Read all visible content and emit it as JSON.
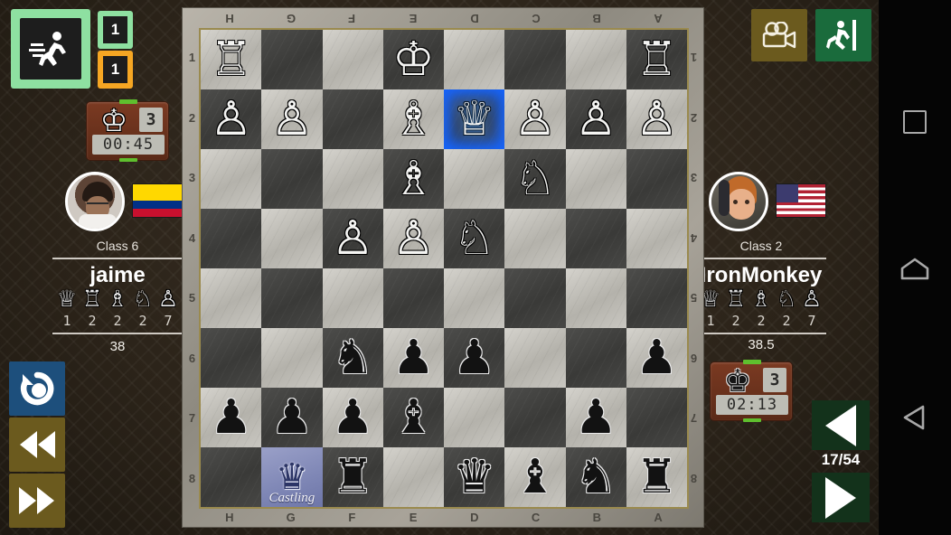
{
  "hud": {
    "run_icon": "running-man-icon",
    "counter_green": "1",
    "counter_amber": "1",
    "record_icon": "video-camera-icon",
    "exit_icon": "exit-door-icon",
    "rotate_icon": "rotate-refresh-icon",
    "rewind_icon": "rewind-icon",
    "forward_icon": "fast-forward-icon"
  },
  "clocks": {
    "white": {
      "time": "00:45",
      "increment": "3",
      "king": "white-king-icon"
    },
    "black": {
      "time": "02:13",
      "increment": "3",
      "king": "black-king-icon"
    }
  },
  "players": {
    "left": {
      "class": "Class 6",
      "name": "jaime",
      "flag": "colombia-flag",
      "score": "38",
      "material": [
        {
          "piece": "queen",
          "glyph": "♕",
          "count": "1"
        },
        {
          "piece": "rook",
          "glyph": "♖",
          "count": "2"
        },
        {
          "piece": "bishop",
          "glyph": "♗",
          "count": "2"
        },
        {
          "piece": "knight",
          "glyph": "♘",
          "count": "2"
        },
        {
          "piece": "pawn",
          "glyph": "♙",
          "count": "7"
        }
      ]
    },
    "right": {
      "class": "Class 2",
      "name": "IronMonkey",
      "flag": "usa-flag",
      "score": "38.5",
      "material": [
        {
          "piece": "queen",
          "glyph": "♕",
          "count": "1"
        },
        {
          "piece": "rook",
          "glyph": "♖",
          "count": "2"
        },
        {
          "piece": "bishop",
          "glyph": "♗",
          "count": "2"
        },
        {
          "piece": "knight",
          "glyph": "♘",
          "count": "2"
        },
        {
          "piece": "pawn",
          "glyph": "♙",
          "count": "7"
        }
      ]
    }
  },
  "move_nav": {
    "counter": "17/54",
    "prev_label": "prev-move",
    "next_label": "next-move"
  },
  "board": {
    "files": [
      "H",
      "G",
      "F",
      "E",
      "D",
      "C",
      "B",
      "A"
    ],
    "ranks": [
      "1",
      "2",
      "3",
      "4",
      "5",
      "6",
      "7",
      "8"
    ],
    "selected_square": "D2",
    "castling_square": "G8",
    "castling_label": "Castling",
    "squares": [
      [
        {
          "p": "R",
          "c": "w"
        },
        {
          "p": "",
          "c": ""
        },
        {
          "p": "",
          "c": ""
        },
        {
          "p": "K",
          "c": "w"
        },
        {
          "p": "",
          "c": ""
        },
        {
          "p": "",
          "c": ""
        },
        {
          "p": "",
          "c": ""
        },
        {
          "p": "R",
          "c": "w"
        }
      ],
      [
        {
          "p": "P",
          "c": "w"
        },
        {
          "p": "P",
          "c": "w"
        },
        {
          "p": "",
          "c": ""
        },
        {
          "p": "B",
          "c": "w"
        },
        {
          "p": "Q",
          "c": "w"
        },
        {
          "p": "P",
          "c": "w"
        },
        {
          "p": "P",
          "c": "w"
        },
        {
          "p": "P",
          "c": "w"
        }
      ],
      [
        {
          "p": "",
          "c": ""
        },
        {
          "p": "",
          "c": ""
        },
        {
          "p": "",
          "c": ""
        },
        {
          "p": "B",
          "c": "w"
        },
        {
          "p": "",
          "c": ""
        },
        {
          "p": "N",
          "c": "w"
        },
        {
          "p": "",
          "c": ""
        },
        {
          "p": "",
          "c": ""
        }
      ],
      [
        {
          "p": "",
          "c": ""
        },
        {
          "p": "",
          "c": ""
        },
        {
          "p": "P",
          "c": "w"
        },
        {
          "p": "P",
          "c": "w"
        },
        {
          "p": "N",
          "c": "w"
        },
        {
          "p": "",
          "c": ""
        },
        {
          "p": "",
          "c": ""
        },
        {
          "p": "",
          "c": ""
        }
      ],
      [
        {
          "p": "",
          "c": ""
        },
        {
          "p": "",
          "c": ""
        },
        {
          "p": "",
          "c": ""
        },
        {
          "p": "",
          "c": ""
        },
        {
          "p": "",
          "c": ""
        },
        {
          "p": "",
          "c": ""
        },
        {
          "p": "",
          "c": ""
        },
        {
          "p": "",
          "c": ""
        }
      ],
      [
        {
          "p": "",
          "c": ""
        },
        {
          "p": "",
          "c": ""
        },
        {
          "p": "N",
          "c": "b"
        },
        {
          "p": "P",
          "c": "b"
        },
        {
          "p": "P",
          "c": "b"
        },
        {
          "p": "",
          "c": ""
        },
        {
          "p": "",
          "c": ""
        },
        {
          "p": "P",
          "c": "b"
        }
      ],
      [
        {
          "p": "P",
          "c": "b"
        },
        {
          "p": "P",
          "c": "b"
        },
        {
          "p": "P",
          "c": "b"
        },
        {
          "p": "B",
          "c": "b"
        },
        {
          "p": "",
          "c": ""
        },
        {
          "p": "",
          "c": ""
        },
        {
          "p": "P",
          "c": "b"
        },
        {
          "p": "",
          "c": ""
        }
      ],
      [
        {
          "p": "",
          "c": ""
        },
        {
          "p": "CASTLE",
          "c": ""
        },
        {
          "p": "R",
          "c": "b"
        },
        {
          "p": "",
          "c": ""
        },
        {
          "p": "Q",
          "c": "b"
        },
        {
          "p": "B",
          "c": "b"
        },
        {
          "p": "N",
          "c": "b"
        },
        {
          "p": "R",
          "c": "b"
        }
      ]
    ]
  },
  "navbar": {
    "recents": "recents-square-icon",
    "home": "home-pentagon-icon",
    "back": "back-triangle-icon"
  },
  "colors": {
    "accent_green": "#8ee0a1",
    "accent_amber": "#f5a623",
    "exit_green": "#1a6b3c",
    "olive": "#6b5a1e",
    "blue": "#1d4f7c",
    "select_glow": "#1464ff"
  }
}
